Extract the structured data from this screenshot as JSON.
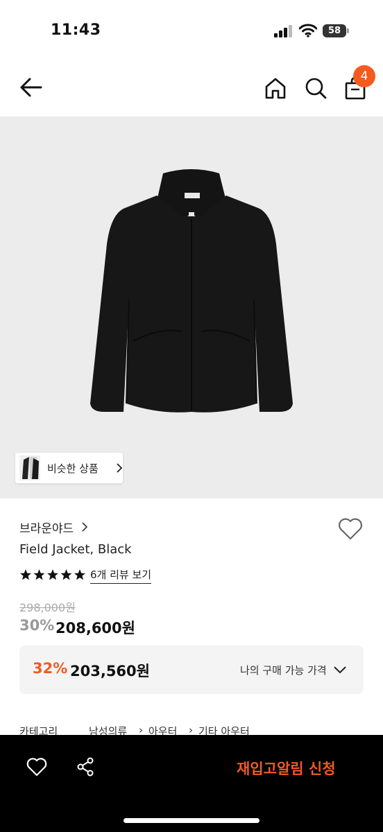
{
  "status_bar": {
    "time": "11:43",
    "battery": "58"
  },
  "nav": {
    "back_icon": "arrow-left-icon",
    "home_icon": "home-icon",
    "search_icon": "search-icon",
    "bag_icon": "shopping-bag-icon",
    "cart_count": "4",
    "badge_color": "#f55a1f"
  },
  "product": {
    "similar_label": "비슷한 상품",
    "brand": "브라운야드",
    "name": "Field Jacket, Black",
    "rating": 5,
    "review_link": "6개 리뷰 보기",
    "original_price": "298,000원",
    "discount_percent": "30%",
    "sale_price": "208,600원"
  },
  "my_price": {
    "percent": "32%",
    "amount": "203,560원",
    "label": "나의 구매 가능 가격",
    "accent_color": "#f05a23"
  },
  "category": {
    "label": "카테고리",
    "path": [
      "남성의류",
      "아우터",
      "기타 아우터"
    ]
  },
  "bottom_bar": {
    "restock_label": "재입고알림 신청",
    "heart_icon": "heart-icon",
    "share_icon": "share-icon"
  }
}
